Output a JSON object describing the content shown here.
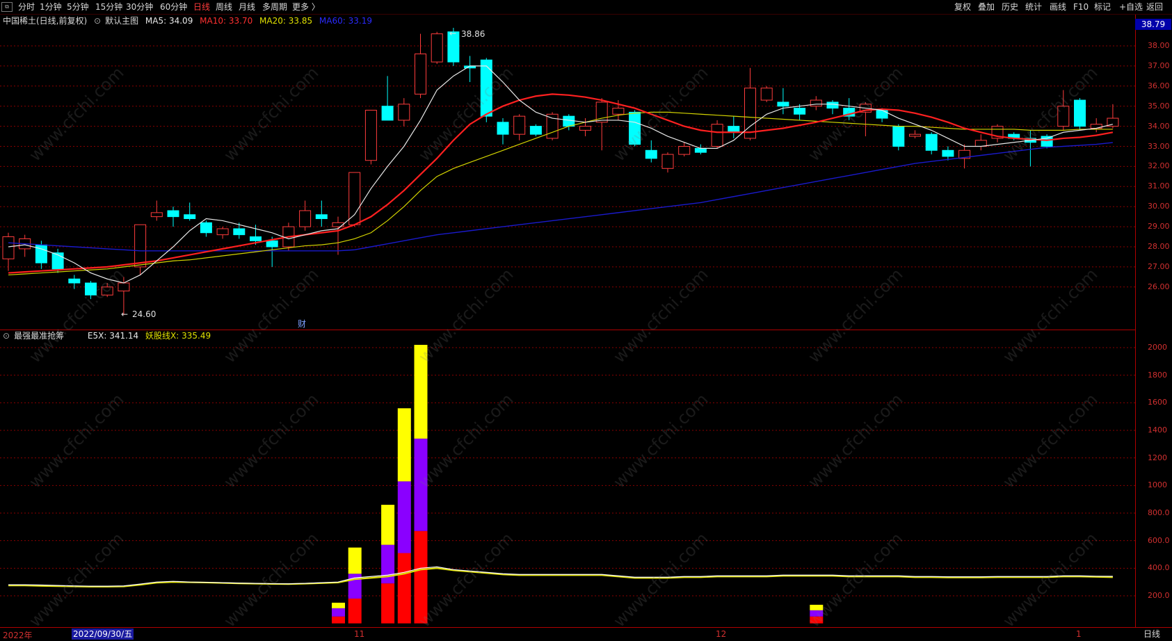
{
  "toolbar": {
    "left_items": [
      "分时",
      "1分钟",
      "5分钟",
      "15分钟",
      "30分钟",
      "60分钟",
      "日线",
      "周线",
      "月线",
      "多周期",
      "更多 〉"
    ],
    "active_item": "日线",
    "right_items": [
      "复权",
      "叠加",
      "历史",
      "统计",
      "画线",
      "F10",
      "标记",
      "+自选",
      "返回"
    ]
  },
  "main_legend": {
    "stock": "中国稀土(日线,前复权)",
    "template": "默认主图",
    "ma5": "MA5: 34.09",
    "ma10": "MA10: 33.70",
    "ma20": "MA20: 33.85",
    "ma60": "MA60: 33.19"
  },
  "indicator_legend": {
    "name": "最强最准抢筹",
    "e5x": "E5X: 341.14",
    "yao": "妖股线X: 335.49"
  },
  "price_tag": "38.79",
  "annotations": {
    "high": "38.86",
    "low": "24.60",
    "fin_marker": "财"
  },
  "price_axis_ticks": [
    "38.00",
    "37.00",
    "36.00",
    "35.00",
    "34.00",
    "33.00",
    "32.00",
    "31.00",
    "30.00",
    "29.00",
    "28.00",
    "27.00",
    "26.00"
  ],
  "indicator_axis_ticks": [
    "2000",
    "1800",
    "1600",
    "1400",
    "1200",
    "1000",
    "800.0",
    "600.0",
    "400.0",
    "200.0"
  ],
  "date_axis": {
    "year": "2022年",
    "selected_date": "2022/09/30/五",
    "month_labels": [
      "11",
      "12",
      "1"
    ],
    "period": "日线"
  },
  "watermark": "www.cfchi.com",
  "colors": {
    "up": "#ff3c3c",
    "down": "#00ffff",
    "ma5": "#e8e8e8",
    "ma10": "#ff2020",
    "ma20": "#d4d400",
    "ma60": "#1a1acc",
    "bar_red": "#ff0000",
    "bar_purple": "#8a00ff",
    "bar_yellow": "#ffff00",
    "grid": "#8b0000"
  },
  "chart_data": {
    "type": "candlestick",
    "ylim": [
      24.6,
      38.9
    ],
    "candles": [
      [
        27.4,
        28.5,
        28.7,
        26.8
      ],
      [
        27.9,
        28.4,
        28.6,
        27.5
      ],
      [
        28.1,
        27.2,
        28.3,
        26.9
      ],
      [
        27.7,
        26.9,
        27.9,
        26.7
      ],
      [
        26.4,
        26.2,
        26.6,
        25.9
      ],
      [
        26.2,
        25.6,
        26.3,
        25.4
      ],
      [
        25.6,
        26.0,
        26.2,
        25.5
      ],
      [
        25.8,
        26.2,
        26.5,
        24.6
      ],
      [
        27.0,
        29.1,
        29.1,
        26.6
      ],
      [
        29.5,
        29.7,
        30.3,
        29.3
      ],
      [
        29.8,
        29.5,
        30.0,
        29.0
      ],
      [
        29.6,
        29.4,
        30.2,
        29.3
      ],
      [
        29.2,
        28.7,
        29.3,
        28.5
      ],
      [
        28.6,
        28.9,
        29.0,
        28.4
      ],
      [
        28.9,
        28.6,
        29.2,
        28.4
      ],
      [
        28.5,
        28.3,
        29.1,
        28.1
      ],
      [
        28.3,
        28.0,
        28.5,
        27.0
      ],
      [
        28.0,
        29.0,
        29.2,
        27.8
      ],
      [
        29.0,
        29.8,
        30.3,
        28.8
      ],
      [
        29.6,
        29.4,
        30.3,
        29.0
      ],
      [
        29.0,
        29.2,
        29.5,
        27.6
      ],
      [
        29.1,
        31.7,
        31.7,
        29.0
      ],
      [
        32.3,
        34.8,
        34.8,
        32.1
      ],
      [
        35.0,
        34.3,
        36.5,
        34.3
      ],
      [
        34.3,
        35.1,
        35.4,
        34.0
      ],
      [
        35.6,
        37.6,
        38.6,
        35.4
      ],
      [
        37.2,
        38.6,
        38.7,
        37.1
      ],
      [
        38.7,
        37.2,
        38.9,
        37.0
      ],
      [
        37.0,
        36.9,
        37.5,
        36.2
      ],
      [
        37.3,
        34.5,
        37.4,
        34.2
      ],
      [
        34.2,
        33.6,
        34.4,
        33.1
      ],
      [
        33.6,
        34.5,
        34.6,
        33.3
      ],
      [
        34.0,
        33.6,
        34.1,
        33.5
      ],
      [
        33.4,
        34.6,
        34.7,
        33.3
      ],
      [
        34.5,
        34.0,
        34.6,
        33.8
      ],
      [
        33.8,
        34.0,
        34.4,
        33.5
      ],
      [
        34.2,
        35.2,
        35.4,
        32.8
      ],
      [
        34.6,
        34.9,
        35.3,
        34.3
      ],
      [
        34.7,
        33.1,
        34.8,
        33.0
      ],
      [
        32.8,
        32.4,
        33.3,
        32.2
      ],
      [
        31.9,
        32.6,
        32.7,
        31.7
      ],
      [
        32.6,
        33.0,
        33.2,
        32.5
      ],
      [
        32.9,
        32.7,
        33.1,
        32.6
      ],
      [
        33.0,
        34.1,
        34.3,
        32.9
      ],
      [
        34.0,
        33.7,
        34.5,
        33.4
      ],
      [
        33.4,
        35.9,
        36.9,
        33.3
      ],
      [
        35.3,
        35.9,
        36.0,
        35.2
      ],
      [
        35.2,
        35.0,
        35.9,
        34.6
      ],
      [
        34.9,
        34.6,
        35.1,
        34.3
      ],
      [
        35.0,
        35.3,
        35.5,
        34.8
      ],
      [
        35.2,
        34.9,
        35.3,
        34.6
      ],
      [
        34.9,
        34.5,
        35.4,
        34.3
      ],
      [
        34.7,
        35.1,
        35.2,
        33.5
      ],
      [
        34.8,
        34.4,
        34.9,
        34.2
      ],
      [
        34.0,
        33.0,
        34.1,
        32.8
      ],
      [
        33.5,
        33.6,
        33.8,
        33.4
      ],
      [
        33.6,
        32.8,
        33.7,
        32.6
      ],
      [
        32.8,
        32.5,
        33.0,
        32.3
      ],
      [
        32.4,
        32.8,
        33.1,
        31.9
      ],
      [
        33.0,
        33.3,
        33.6,
        32.8
      ],
      [
        33.4,
        34.0,
        34.1,
        33.2
      ],
      [
        33.6,
        33.4,
        33.7,
        33.3
      ],
      [
        33.4,
        33.2,
        33.8,
        32.0
      ],
      [
        33.5,
        33.0,
        33.6,
        32.9
      ],
      [
        34.0,
        35.0,
        35.8,
        33.8
      ],
      [
        35.3,
        34.0,
        35.4,
        33.8
      ],
      [
        33.9,
        34.1,
        34.4,
        33.7
      ],
      [
        34.0,
        34.4,
        35.1,
        33.9
      ]
    ],
    "ma5": [
      28.0,
      28.1,
      27.9,
      27.6,
      27.2,
      26.7,
      26.4,
      26.2,
      26.6,
      27.3,
      28.0,
      28.8,
      29.4,
      29.3,
      29.1,
      28.9,
      28.7,
      28.4,
      28.6,
      28.8,
      28.9,
      29.6,
      30.9,
      32.0,
      33.0,
      34.3,
      35.8,
      36.5,
      37.0,
      37.0,
      36.2,
      35.3,
      34.7,
      34.4,
      34.3,
      34.2,
      34.3,
      34.3,
      34.2,
      33.9,
      33.5,
      33.2,
      32.9,
      32.9,
      33.3,
      34.0,
      34.6,
      34.9,
      35.0,
      35.1,
      35.1,
      35.0,
      34.9,
      34.8,
      34.4,
      34.1,
      33.8,
      33.4,
      33.0,
      33.0,
      33.1,
      33.2,
      33.3,
      33.4,
      33.7,
      33.8,
      33.9,
      34.1
    ],
    "ma10": [
      26.7,
      26.75,
      26.8,
      26.85,
      26.9,
      26.95,
      27.0,
      27.1,
      27.2,
      27.3,
      27.45,
      27.6,
      27.75,
      27.9,
      28.05,
      28.2,
      28.35,
      28.5,
      28.6,
      28.7,
      28.8,
      29.1,
      29.5,
      30.1,
      30.8,
      31.6,
      32.4,
      33.3,
      34.1,
      34.6,
      35.0,
      35.3,
      35.5,
      35.6,
      35.55,
      35.45,
      35.3,
      35.1,
      34.9,
      34.6,
      34.3,
      34.0,
      33.8,
      33.7,
      33.7,
      33.7,
      33.8,
      33.9,
      34.05,
      34.2,
      34.4,
      34.6,
      34.8,
      34.85,
      34.8,
      34.65,
      34.45,
      34.2,
      33.9,
      33.7,
      33.5,
      33.4,
      33.35,
      33.3,
      33.4,
      33.45,
      33.55,
      33.7
    ],
    "ma20": [
      26.6,
      26.65,
      26.7,
      26.75,
      26.8,
      26.85,
      26.9,
      27.0,
      27.1,
      27.2,
      27.3,
      27.35,
      27.45,
      27.55,
      27.65,
      27.75,
      27.85,
      27.95,
      28.05,
      28.1,
      28.2,
      28.4,
      28.7,
      29.3,
      30.0,
      30.8,
      31.5,
      31.9,
      32.2,
      32.5,
      32.8,
      33.1,
      33.4,
      33.7,
      34.0,
      34.2,
      34.4,
      34.55,
      34.65,
      34.7,
      34.7,
      34.65,
      34.6,
      34.55,
      34.5,
      34.45,
      34.4,
      34.35,
      34.3,
      34.25,
      34.2,
      34.15,
      34.1,
      34.05,
      34.0,
      34.0,
      33.95,
      33.9,
      33.85,
      33.85,
      33.85,
      33.85,
      33.8,
      33.8,
      33.8,
      33.85,
      33.85,
      33.85
    ],
    "ma60": [
      28.2,
      28.15,
      28.1,
      28.05,
      28.0,
      27.95,
      27.9,
      27.85,
      27.8,
      27.8,
      27.8,
      27.8,
      27.8,
      27.8,
      27.8,
      27.8,
      27.8,
      27.8,
      27.8,
      27.8,
      27.8,
      27.85,
      28.0,
      28.15,
      28.3,
      28.45,
      28.6,
      28.7,
      28.8,
      28.9,
      29.0,
      29.1,
      29.2,
      29.3,
      29.4,
      29.5,
      29.6,
      29.7,
      29.8,
      29.9,
      30.0,
      30.1,
      30.2,
      30.35,
      30.5,
      30.65,
      30.8,
      30.95,
      31.1,
      31.25,
      31.4,
      31.55,
      31.7,
      31.85,
      32.0,
      32.15,
      32.25,
      32.35,
      32.45,
      32.55,
      32.65,
      32.75,
      32.85,
      32.95,
      33.0,
      33.05,
      33.1,
      33.19
    ],
    "indicator": {
      "ylim": [
        0,
        2100
      ],
      "stacked_bars": [
        {
          "index": 20,
          "red": 50,
          "purple": 60,
          "yellow": 40
        },
        {
          "index": 21,
          "red": 180,
          "purple": 180,
          "yellow": 190
        },
        {
          "index": 23,
          "red": 290,
          "purple": 280,
          "yellow": 290
        },
        {
          "index": 24,
          "red": 510,
          "purple": 520,
          "yellow": 530
        },
        {
          "index": 25,
          "red": 670,
          "purple": 670,
          "yellow": 680
        },
        {
          "index": 49,
          "red": 50,
          "purple": 45,
          "yellow": 40
        }
      ],
      "e5x": [
        280,
        280,
        278,
        275,
        272,
        270,
        270,
        272,
        285,
        300,
        305,
        300,
        298,
        295,
        292,
        290,
        288,
        287,
        290,
        295,
        300,
        330,
        340,
        350,
        370,
        400,
        410,
        390,
        380,
        370,
        360,
        355,
        355,
        355,
        355,
        355,
        355,
        345,
        335,
        335,
        335,
        340,
        340,
        345,
        345,
        345,
        345,
        350,
        350,
        350,
        350,
        345,
        345,
        345,
        345,
        340,
        340,
        338,
        338,
        338,
        340,
        340,
        340,
        340,
        345,
        345,
        342,
        341
      ],
      "yao": [
        275,
        275,
        272,
        270,
        268,
        266,
        266,
        268,
        280,
        295,
        300,
        298,
        296,
        293,
        290,
        288,
        286,
        285,
        288,
        292,
        296,
        320,
        330,
        340,
        360,
        390,
        400,
        385,
        375,
        365,
        355,
        350,
        350,
        350,
        350,
        350,
        350,
        340,
        330,
        330,
        330,
        335,
        335,
        340,
        340,
        340,
        340,
        345,
        345,
        345,
        345,
        340,
        340,
        340,
        340,
        335,
        335,
        333,
        333,
        333,
        335,
        335,
        335,
        335,
        340,
        340,
        337,
        335
      ]
    }
  }
}
